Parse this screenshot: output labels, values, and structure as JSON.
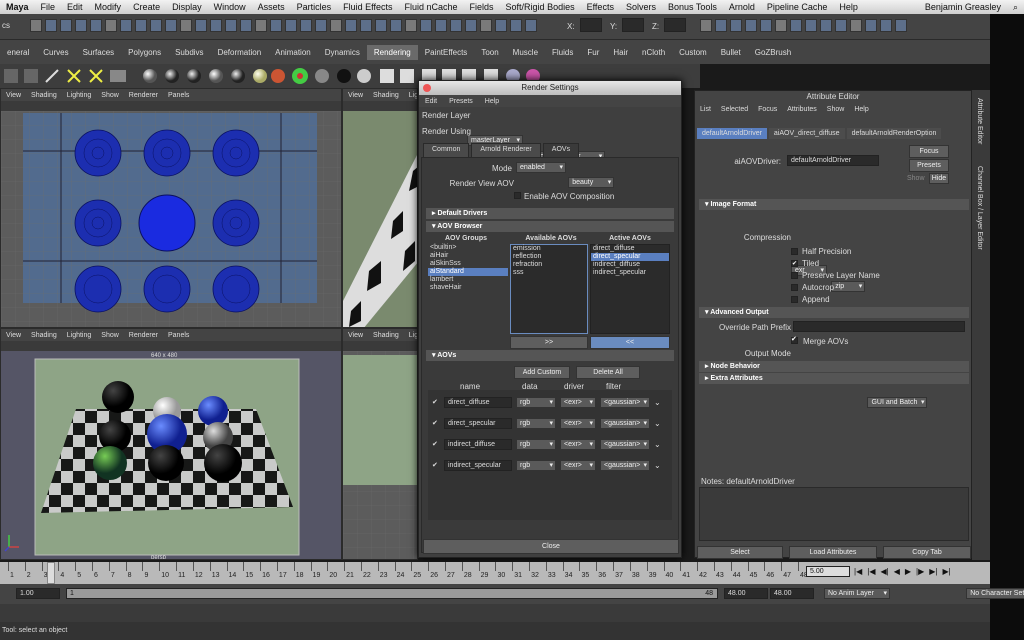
{
  "mac_menu": [
    "Maya",
    "File",
    "Edit",
    "Modify",
    "Create",
    "Display",
    "Window",
    "Assets",
    "Particles",
    "Fluid Effects",
    "Fluid nCache",
    "Fields",
    "Soft/Rigid Bodies",
    "Effects",
    "Solvers",
    "Bonus Tools",
    "Arnold",
    "Pipeline Cache",
    "Help"
  ],
  "user_name": "Benjamin Greasley",
  "status_line": {
    "mode": "cs",
    "x_label": "X:",
    "y_label": "Y:",
    "z_label": "Z:"
  },
  "shelf_tabs": [
    "eneral",
    "Curves",
    "Surfaces",
    "Polygons",
    "Subdivs",
    "Deformation",
    "Animation",
    "Dynamics",
    "Rendering",
    "PaintEffects",
    "Toon",
    "Muscle",
    "Fluids",
    "Fur",
    "Hair",
    "nCloth",
    "Custom",
    "Bullet",
    "GoZBrush"
  ],
  "shelf_active": "Rendering",
  "viewport_menu": [
    "View",
    "Shading",
    "Lighting",
    "Show",
    "Renderer",
    "Panels"
  ],
  "viewport_resolution": "640 x 480",
  "camera_label": "persp",
  "render_settings": {
    "title": "Render Settings",
    "menu": [
      "Edit",
      "Presets",
      "Help"
    ],
    "render_layer_label": "Render Layer",
    "render_layer_value": "masterLayer",
    "render_using_label": "Render Using",
    "render_using_value": "Arnold Renderer",
    "tabs": [
      "Common",
      "Arnold Renderer",
      "AOVs"
    ],
    "active_tab": "AOVs",
    "mode_label": "Mode",
    "mode_value": "enabled",
    "render_view_aov_label": "Render View AOV",
    "render_view_aov_value": "beauty",
    "enable_composition_label": "Enable AOV Composition",
    "default_drivers": "Default Drivers",
    "aov_browser": "AOV Browser",
    "aov_groups_hdr": "AOV Groups",
    "available_aovs_hdr": "Available AOVs",
    "active_aovs_hdr": "Active AOVs",
    "aov_groups": [
      "<builtin>",
      "aiHair",
      "aiSkinSss",
      "aiStandard",
      "lambert",
      "shaveHair"
    ],
    "aov_groups_selected": "aiStandard",
    "available_aovs": [
      "emission",
      "reflection",
      "refraction",
      "sss"
    ],
    "active_aovs": [
      "direct_diffuse",
      "direct_specular",
      "indirect_diffuse",
      "indirect_specular"
    ],
    "active_aovs_selected": "direct_specular",
    "add_btn": ">>",
    "remove_btn": "<<",
    "aovs_section": "AOVs",
    "add_custom": "Add Custom",
    "delete_all": "Delete All",
    "col_name": "name",
    "col_data": "data",
    "col_driver": "driver",
    "col_filter": "filter",
    "rows": [
      {
        "name": "direct_diffuse",
        "data": "rgb",
        "driver": "<exr>",
        "filter": "<gaussian>"
      },
      {
        "name": "direct_specular",
        "data": "rgb",
        "driver": "<exr>",
        "filter": "<gaussian>"
      },
      {
        "name": "indirect_diffuse",
        "data": "rgb",
        "driver": "<exr>",
        "filter": "<gaussian>"
      },
      {
        "name": "indirect_specular",
        "data": "rgb",
        "driver": "<exr>",
        "filter": "<gaussian>"
      }
    ],
    "close": "Close"
  },
  "attr_editor": {
    "title": "Attribute Editor",
    "menu": [
      "List",
      "Selected",
      "Focus",
      "Attributes",
      "Show",
      "Help"
    ],
    "tabs": [
      "defaultArnoldDriver",
      "aiAOV_direct_diffuse",
      "defaultArnoldRenderOption"
    ],
    "driver_label": "aiAOVDriver:",
    "driver_value": "defaultArnoldDriver",
    "focus_btn": "Focus",
    "presets_btn": "Presets",
    "show_btn": "Show",
    "hide_btn": "Hide",
    "image_format_hdr": "Image Format",
    "format_value": "exr",
    "compression_label": "Compression",
    "compression_value": "zip",
    "checkboxes": [
      {
        "label": "Half Precision",
        "checked": false
      },
      {
        "label": "Tiled",
        "checked": true
      },
      {
        "label": "Preserve Layer Name",
        "checked": false
      },
      {
        "label": "Autocrop",
        "checked": false
      },
      {
        "label": "Append",
        "checked": false
      }
    ],
    "advanced_output_hdr": "Advanced Output",
    "override_prefix_label": "Override Path Prefix",
    "merge_aovs_label": "Merge AOVs",
    "output_mode_label": "Output Mode",
    "output_mode_value": "GUI and Batch",
    "node_behavior_hdr": "Node Behavior",
    "extra_attrs_hdr": "Extra Attributes",
    "notes_label": "Notes: defaultArnoldDriver",
    "select_btn": "Select",
    "load_attrs_btn": "Load Attributes",
    "copy_tab_btn": "Copy Tab"
  },
  "side_tabs": [
    "Attribute Editor",
    "Channel Box / Layer Editor"
  ],
  "timeline": {
    "ticks": [
      "1",
      "2",
      "3",
      "4",
      "5",
      "6",
      "7",
      "8",
      "9",
      "10",
      "11",
      "12",
      "13",
      "14",
      "15",
      "16",
      "17",
      "18",
      "19",
      "20",
      "21",
      "22",
      "23",
      "24",
      "25",
      "26",
      "27",
      "28",
      "29",
      "30",
      "31",
      "32",
      "33",
      "34",
      "35",
      "36",
      "37",
      "38",
      "39",
      "40",
      "41",
      "42",
      "43",
      "44",
      "45",
      "46",
      "47",
      "48"
    ],
    "current_frame": "5.00"
  },
  "range": {
    "start": "1.00",
    "sub_start": "1",
    "end_field": "48",
    "anim_end": "48.00",
    "range_end": "48.00",
    "anim_layer": "No Anim Layer",
    "char_set": "No Character Set"
  },
  "help_text": "Tool: select an object"
}
